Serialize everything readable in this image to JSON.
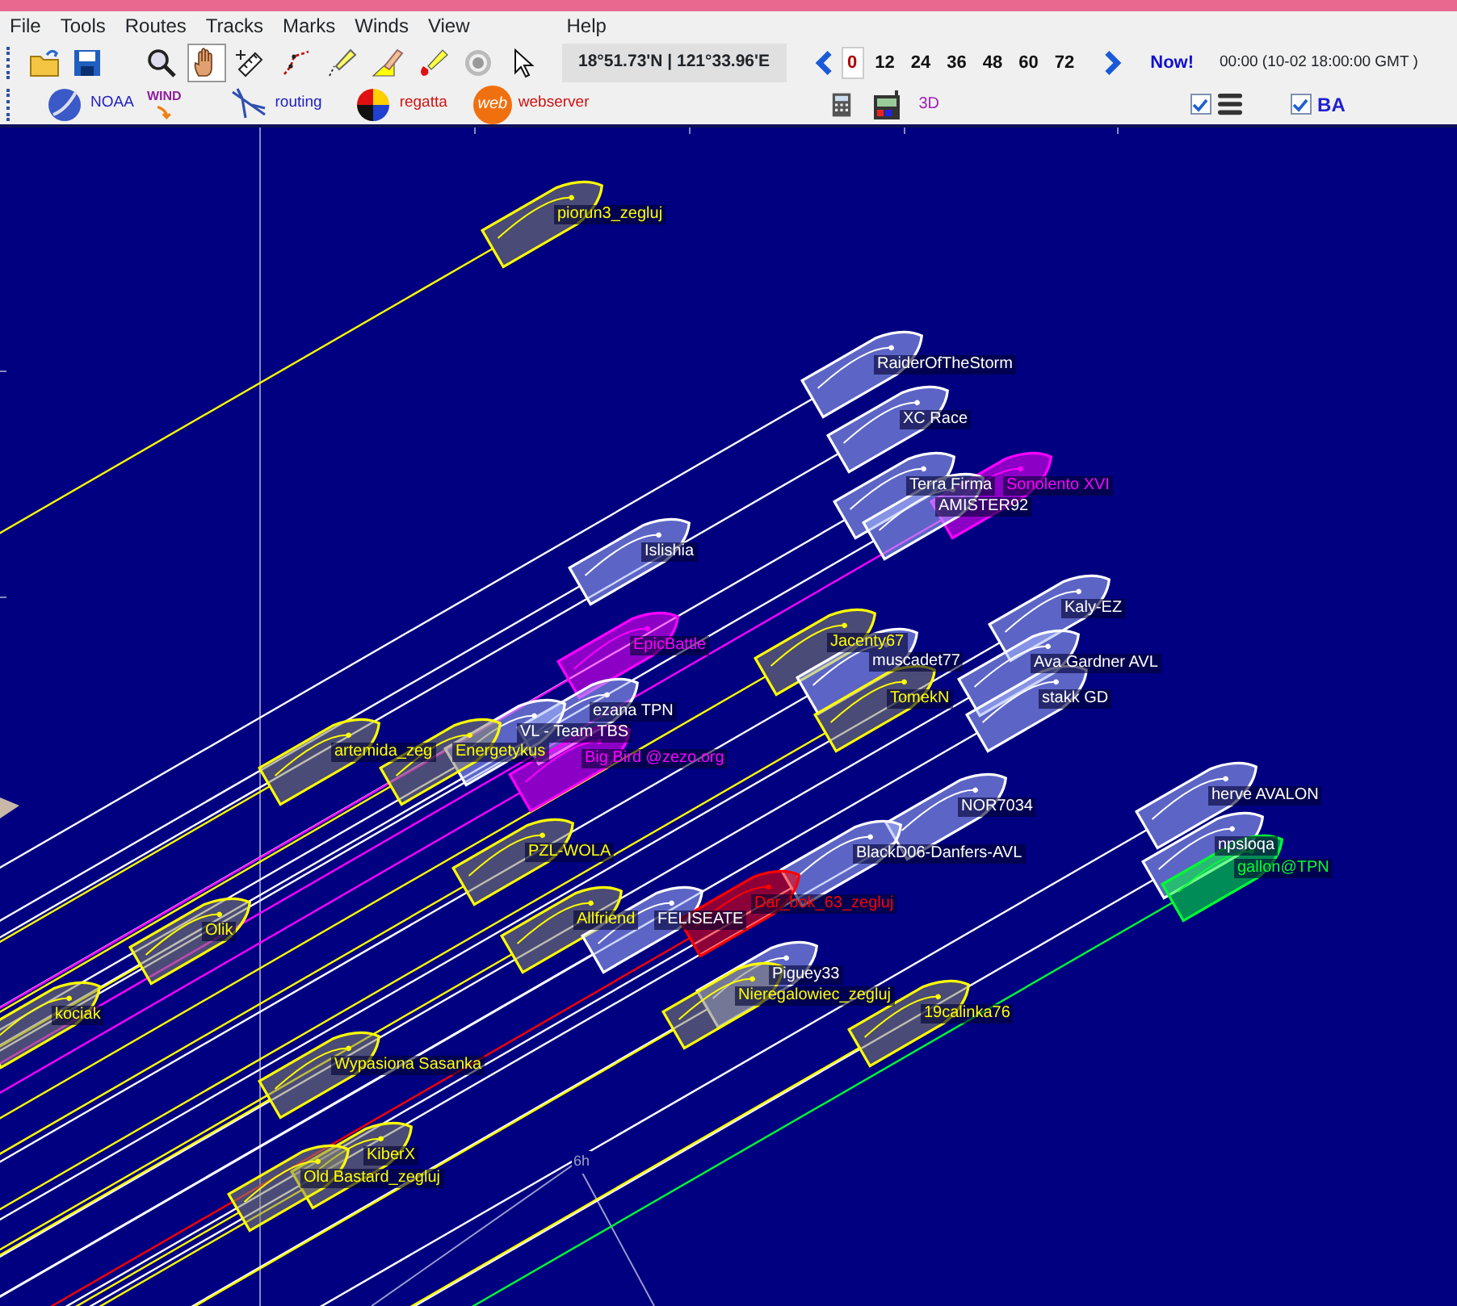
{
  "menu": [
    {
      "label": "File"
    },
    {
      "label": "Tools"
    },
    {
      "label": "Routes"
    },
    {
      "label": "Tracks"
    },
    {
      "label": "Marks"
    },
    {
      "label": "Winds"
    },
    {
      "label": "View"
    },
    {
      "label": "Help"
    }
  ],
  "tools": [
    {
      "kind": "open",
      "selected": false
    },
    {
      "kind": "save",
      "selected": false
    },
    {
      "kind": "zoom",
      "selected": false
    },
    {
      "kind": "pan",
      "selected": true
    },
    {
      "kind": "measure",
      "selected": false
    },
    {
      "kind": "route",
      "selected": false
    },
    {
      "kind": "pencil",
      "selected": false
    },
    {
      "kind": "mark",
      "selected": false
    },
    {
      "kind": "paint",
      "selected": false
    },
    {
      "kind": "target",
      "selected": false
    },
    {
      "kind": "select",
      "selected": false
    }
  ],
  "coordinates": "18°51.73'N | 121°33.96'E",
  "forecast_hours": [
    {
      "label": "0",
      "selected": true
    },
    {
      "label": "12",
      "selected": false
    },
    {
      "label": "24",
      "selected": false
    },
    {
      "label": "36",
      "selected": false
    },
    {
      "label": "48",
      "selected": false
    },
    {
      "label": "60",
      "selected": false
    },
    {
      "label": "72",
      "selected": false
    }
  ],
  "now_link": "Now!",
  "time": "00:00 (10-02 18:00:00 GMT )",
  "plugins": [
    {
      "kind": "noaa",
      "label": "NOAA"
    },
    {
      "kind": "wind",
      "label": "WIND"
    },
    {
      "kind": "routing",
      "label": "routing"
    },
    {
      "kind": "regatta",
      "label": "regatta"
    },
    {
      "kind": "web",
      "badge": "web",
      "label": "webserver"
    }
  ],
  "three_d": "3D",
  "view_toggles": [
    {
      "kind": "layers",
      "checked": true
    },
    {
      "kind": "label",
      "label": "BA",
      "checked": true
    }
  ],
  "map": {
    "scale_label": "6h",
    "boats": [
      {
        "name": "piorun3_zegluj",
        "color": "#ffff00"
      },
      {
        "name": "RaiderOfTheStorm",
        "color": "#ffffff"
      },
      {
        "name": "XC Race",
        "color": "#ffffff"
      },
      {
        "name": "Terra Firma",
        "color": "#ffffff"
      },
      {
        "name": "Sonolento XVI",
        "color": "#ff00ff"
      },
      {
        "name": "AMISTER92",
        "color": "#ffffff"
      },
      {
        "name": "Islishia",
        "color": "#ffffff"
      },
      {
        "name": "Kaly-EZ",
        "color": "#ffffff"
      },
      {
        "name": "EpicBattle",
        "color": "#ff00ff"
      },
      {
        "name": "Jacenty67",
        "color": "#ffff00"
      },
      {
        "name": "muscadet77",
        "color": "#ffffff"
      },
      {
        "name": "Ava Gardner AVL",
        "color": "#ffffff"
      },
      {
        "name": "TomekN",
        "color": "#ffff00"
      },
      {
        "name": "stakk GD",
        "color": "#ffffff"
      },
      {
        "name": "ezana TPN",
        "color": "#ffffff"
      },
      {
        "name": "VL - Team TBS",
        "color": "#ffffff"
      },
      {
        "name": "artemida_zeg",
        "color": "#ffff00"
      },
      {
        "name": "Energetykus",
        "color": "#ffff00"
      },
      {
        "name": "Big Bird @zezo.org",
        "color": "#ff00ff"
      },
      {
        "name": "PZL-WOLA",
        "color": "#ffff00"
      },
      {
        "name": "Olik",
        "color": "#ffff00"
      },
      {
        "name": "NOR7034",
        "color": "#ffffff"
      },
      {
        "name": "BlackD06-Danfers-AVL",
        "color": "#ffffff"
      },
      {
        "name": "herve AVALON",
        "color": "#ffffff"
      },
      {
        "name": "npsloqa",
        "color": "#ffffff"
      },
      {
        "name": "gallon@TPN",
        "color": "#00ff33"
      },
      {
        "name": "Allfriend",
        "color": "#ffff00"
      },
      {
        "name": "FELISEATE",
        "color": "#ffffff"
      },
      {
        "name": "Dar_bok_63_zegluj",
        "color": "#ff0000"
      },
      {
        "name": "kociak",
        "color": "#ffff00"
      },
      {
        "name": "Piguey33",
        "color": "#ffffff"
      },
      {
        "name": "Nieregalowiec_zegluj",
        "color": "#ffff00"
      },
      {
        "name": "19calinka76",
        "color": "#ffff00"
      },
      {
        "name": "Wypasiona Sasanka",
        "color": "#ffff00"
      },
      {
        "name": "KiberX",
        "color": "#ffff00"
      },
      {
        "name": "Old Bastard_zegluj",
        "color": "#ffff00"
      }
    ]
  }
}
